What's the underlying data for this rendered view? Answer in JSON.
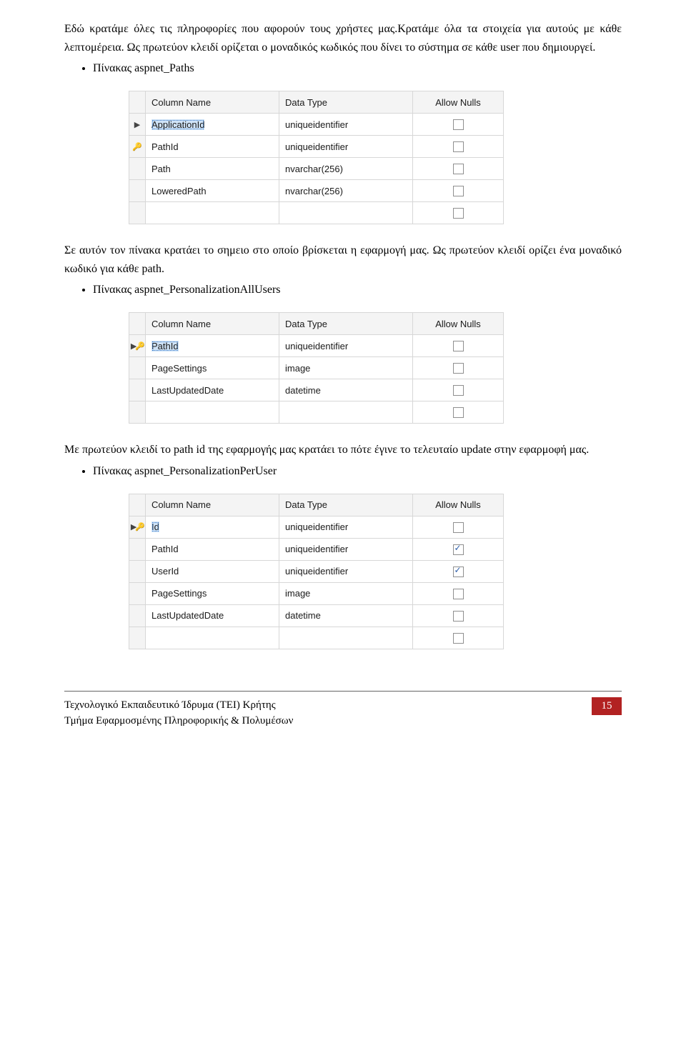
{
  "para1": "Εδώ κρατάμε όλες τις πληροφορίες που αφορούν τους χρήστες μας.Κρατάμε όλα τα στοιχεία για αυτούς με κάθε λεπτομέρεια. Ως πρωτεύον κλειδί ορίζεται ο μοναδικός κωδικός που δίνει το σύστημα σε  κάθε user που δημιουργεί.",
  "bullet1": "Πίνακας  aspnet_Paths",
  "para2": "Σε αυτόν τον πίνακα κρατάει το σημειο στο οποίο βρίσκεται η εφαρμογή μας. Ως πρωτεύον κλειδί ορίζει ένα μοναδικό κωδικό για κάθε path.",
  "bullet2": "Πίνακας  aspnet_PersonalizationAllUsers",
  "para3": "Με πρωτεύον κλειδί το path id της εφαρμογής μας κρατάει το πότε έγινε το τελευταίο update στην εφαρμοφή μας.",
  "bullet3": "Πίνακας  aspnet_PersonalizationPerUser",
  "headers": {
    "col": "Column Name",
    "dtype": "Data Type",
    "allow": "Allow Nulls"
  },
  "table1": {
    "rows": [
      {
        "gutter": "arrow",
        "name": "ApplicationId",
        "sel": true,
        "dtype": "uniqueidentifier",
        "allow": false
      },
      {
        "gutter": "key",
        "name": "PathId",
        "dtype": "uniqueidentifier",
        "allow": false
      },
      {
        "gutter": "",
        "name": "Path",
        "dtype": "nvarchar(256)",
        "allow": false
      },
      {
        "gutter": "",
        "name": "LoweredPath",
        "dtype": "nvarchar(256)",
        "allow": false
      },
      {
        "gutter": "",
        "name": "",
        "dtype": "",
        "allow": false
      }
    ]
  },
  "table2": {
    "rows": [
      {
        "gutter": "ak",
        "name": "PathId",
        "sel": true,
        "dtype": "uniqueidentifier",
        "allow": false
      },
      {
        "gutter": "",
        "name": "PageSettings",
        "dtype": "image",
        "allow": false
      },
      {
        "gutter": "",
        "name": "LastUpdatedDate",
        "dtype": "datetime",
        "allow": false
      },
      {
        "gutter": "",
        "name": "",
        "dtype": "",
        "allow": false
      }
    ]
  },
  "table3": {
    "rows": [
      {
        "gutter": "ak",
        "name": "Id",
        "sel": true,
        "dtype": "uniqueidentifier",
        "allow": false
      },
      {
        "gutter": "",
        "name": "PathId",
        "dtype": "uniqueidentifier",
        "allow": true
      },
      {
        "gutter": "",
        "name": "UserId",
        "dtype": "uniqueidentifier",
        "allow": true
      },
      {
        "gutter": "",
        "name": "PageSettings",
        "dtype": "image",
        "allow": false
      },
      {
        "gutter": "",
        "name": "LastUpdatedDate",
        "dtype": "datetime",
        "allow": false
      },
      {
        "gutter": "",
        "name": "",
        "dtype": "",
        "allow": false
      }
    ]
  },
  "footer": {
    "line1": "Τεχνολογικό Εκπαιδευτικό Ίδρυμα (ΤΕΙ) Κρήτης",
    "line2": "Τμήμα Εφαρμοσμένης Πληροφορικής & Πολυμέσων",
    "page": "15"
  },
  "chart_data": [
    {
      "type": "table",
      "title": "aspnet_Paths",
      "columns": [
        "Column Name",
        "Data Type",
        "Allow Nulls"
      ],
      "rows": [
        [
          "ApplicationId",
          "uniqueidentifier",
          false
        ],
        [
          "PathId",
          "uniqueidentifier",
          false
        ],
        [
          "Path",
          "nvarchar(256)",
          false
        ],
        [
          "LoweredPath",
          "nvarchar(256)",
          false
        ]
      ]
    },
    {
      "type": "table",
      "title": "aspnet_PersonalizationAllUsers",
      "columns": [
        "Column Name",
        "Data Type",
        "Allow Nulls"
      ],
      "rows": [
        [
          "PathId",
          "uniqueidentifier",
          false
        ],
        [
          "PageSettings",
          "image",
          false
        ],
        [
          "LastUpdatedDate",
          "datetime",
          false
        ]
      ]
    },
    {
      "type": "table",
      "title": "aspnet_PersonalizationPerUser",
      "columns": [
        "Column Name",
        "Data Type",
        "Allow Nulls"
      ],
      "rows": [
        [
          "Id",
          "uniqueidentifier",
          false
        ],
        [
          "PathId",
          "uniqueidentifier",
          true
        ],
        [
          "UserId",
          "uniqueidentifier",
          true
        ],
        [
          "PageSettings",
          "image",
          false
        ],
        [
          "LastUpdatedDate",
          "datetime",
          false
        ]
      ]
    }
  ]
}
